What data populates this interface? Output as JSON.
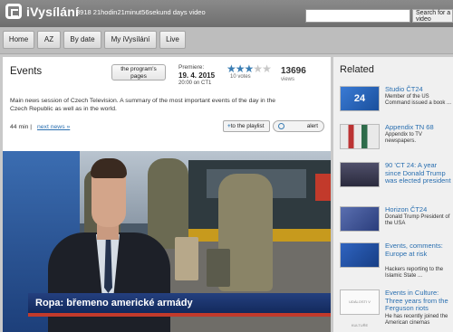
{
  "header": {
    "logo_text": "iVysílání",
    "counter_text": "3918 21hodin21minut56sekund days video",
    "search_placeholder": "",
    "search_button": "Search for a video"
  },
  "nav": {
    "items": [
      {
        "label": "Home"
      },
      {
        "label": "AZ"
      },
      {
        "label": "By date"
      },
      {
        "label": "My iVysílání"
      },
      {
        "label": "Live"
      }
    ]
  },
  "program": {
    "title": "Events",
    "programs_button_line1": "the program's",
    "programs_button_line2": "pages",
    "premiere_label": "Premiere:",
    "premiere_date": "19. 4. 2015",
    "premiere_time": "20:00 on CT1",
    "rating_stars_filled": 3,
    "rating_stars_total": 5,
    "votes": "10 votes",
    "views_count": "13696",
    "views_label": "views",
    "description": "Main news session of Czech Television. A summary of the most important events of the day in the Czech Republic as well as in the world.",
    "duration": "44 min |",
    "next_news": "next news »",
    "playlist_button": "to the playlist",
    "alert_button": "alert"
  },
  "video": {
    "caption": "Ropa: břemeno americké armády"
  },
  "related": {
    "title": "Related",
    "items": [
      {
        "title": "Studio ČT24",
        "desc": "Member of the US Command issued a book ...",
        "thumb_text": "24"
      },
      {
        "title": "Appendix TN 68",
        "desc": "Appendix to TV newspapers.",
        "thumb_text": ""
      },
      {
        "title": "90 'CT 24: A year since Donald Trump was elected president",
        "desc": "",
        "thumb_text": ""
      },
      {
        "title": "Horizon ČT24",
        "desc": "Donald Trump President of the USA",
        "thumb_text": ""
      },
      {
        "title": "Events, comments: Europe at risk",
        "desc": "Hackers reporting to the Islamic State ...",
        "thumb_text": ""
      },
      {
        "title": "Events in Culture: Three years from the Ferguson riots",
        "desc": "He has recently joined the American cinemas",
        "thumb_text": "UDÁLOSTI V KULTUŘE"
      }
    ]
  },
  "colors": {
    "accent": "#2a6fb0",
    "star_on": "#3a7db3",
    "caption_bg": "#24407f"
  }
}
